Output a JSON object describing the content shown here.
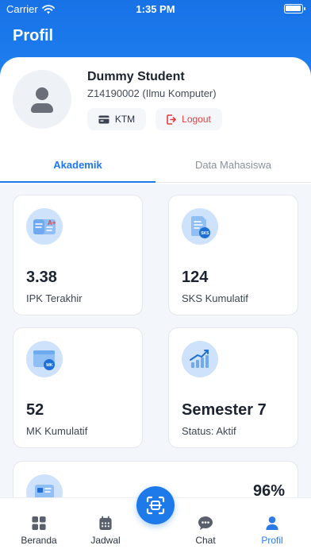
{
  "status_bar": {
    "carrier": "Carrier",
    "time": "1:35 PM",
    "battery_level": 1.0
  },
  "header": {
    "title": "Profil"
  },
  "profile": {
    "name": "Dummy Student",
    "nim": "Z14190002 (Ilmu Komputer)",
    "ktm_label": "KTM",
    "logout_label": "Logout"
  },
  "tabs": [
    {
      "label": "Akademik",
      "active": true
    },
    {
      "label": "Data Mahasiswa",
      "active": false
    }
  ],
  "stats": [
    {
      "value": "3.38",
      "label": "IPK Terakhir",
      "icon": "grades-icon"
    },
    {
      "value": "124",
      "label": "SKS Kumulatif",
      "icon": "sks-document-icon"
    },
    {
      "value": "52",
      "label": "MK Kumulatif",
      "icon": "course-window-icon"
    },
    {
      "value": "Semester 7",
      "label": "Status: Aktif",
      "icon": "growth-chart-icon"
    }
  ],
  "partial_stat": {
    "value": "96%",
    "icon": "attendance-card-icon"
  },
  "bottom_nav": {
    "items": [
      {
        "label": "Beranda",
        "icon": "grid-icon",
        "active": false
      },
      {
        "label": "Jadwal",
        "icon": "calendar-icon",
        "active": false
      },
      {
        "label": "Chat",
        "icon": "chat-bubble-icon",
        "active": false
      },
      {
        "label": "Profil",
        "icon": "user-icon",
        "active": true
      }
    ],
    "fab_icon": "scan-icon"
  },
  "colors": {
    "primary": "#1e78ec",
    "danger": "#e23c3c",
    "icon_bg": "#cfe2fb"
  }
}
